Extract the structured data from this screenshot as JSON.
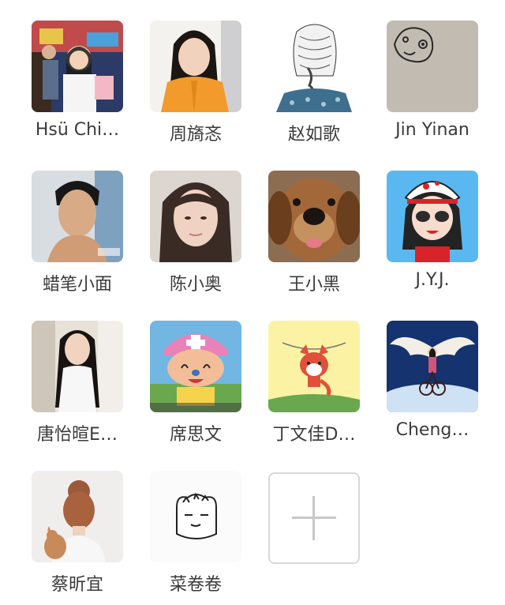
{
  "members": [
    {
      "name": "Hsü Chi…"
    },
    {
      "name": "周旖忞"
    },
    {
      "name": "赵如歌"
    },
    {
      "name": "Jin Yinan"
    },
    {
      "name": "蜡笔小面"
    },
    {
      "name": "陈小奥"
    },
    {
      "name": "王小黑"
    },
    {
      "name": "J.Y.J."
    },
    {
      "name": "唐怡暄E…"
    },
    {
      "name": "席思文"
    },
    {
      "name": "丁文佳D…"
    },
    {
      "name": "Cheng…"
    },
    {
      "name": "蔡昕宜"
    },
    {
      "name": "菜卷卷"
    }
  ],
  "add_button": {
    "icon": "plus-icon"
  }
}
